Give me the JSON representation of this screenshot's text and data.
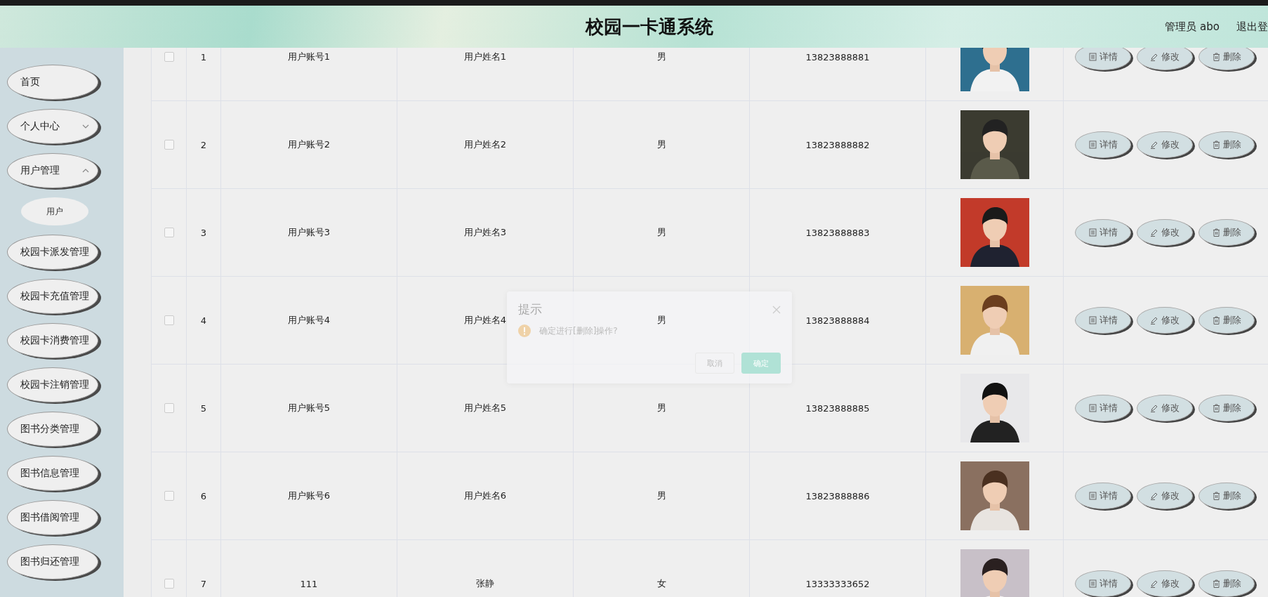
{
  "header": {
    "title": "校园一卡通系统",
    "user_label": "管理员 abo",
    "logout": "退出登"
  },
  "sidebar": {
    "items": [
      {
        "label": "首页",
        "kind": "link"
      },
      {
        "label": "个人中心",
        "kind": "submenu",
        "expanded": false
      },
      {
        "label": "用户管理",
        "kind": "submenu",
        "expanded": true,
        "children": [
          {
            "label": "用户"
          }
        ]
      },
      {
        "label": "校园卡派发管理",
        "kind": "link"
      },
      {
        "label": "校园卡充值管理",
        "kind": "link"
      },
      {
        "label": "校园卡消费管理",
        "kind": "link"
      },
      {
        "label": "校园卡注销管理",
        "kind": "link"
      },
      {
        "label": "图书分类管理",
        "kind": "link"
      },
      {
        "label": "图书信息管理",
        "kind": "link"
      },
      {
        "label": "图书借阅管理",
        "kind": "link"
      },
      {
        "label": "图书归还管理",
        "kind": "link"
      }
    ]
  },
  "table": {
    "rows": [
      {
        "checked": false,
        "index": "1",
        "account": "用户账号1",
        "name": "用户姓名1",
        "gender": "男",
        "phone": "13823888881",
        "actions": [
          {
            "label": "详情",
            "kind": "detail"
          },
          {
            "label": "修改",
            "kind": "edit"
          },
          {
            "label": "删除",
            "kind": "delete"
          }
        ]
      },
      {
        "checked": false,
        "index": "2",
        "account": "用户账号2",
        "name": "用户姓名2",
        "gender": "男",
        "phone": "13823888882",
        "actions": [
          {
            "label": "详情",
            "kind": "detail"
          },
          {
            "label": "修改",
            "kind": "edit"
          },
          {
            "label": "删除",
            "kind": "delete"
          }
        ]
      },
      {
        "checked": false,
        "index": "3",
        "account": "用户账号3",
        "name": "用户姓名3",
        "gender": "男",
        "phone": "13823888883",
        "actions": [
          {
            "label": "详情",
            "kind": "detail"
          },
          {
            "label": "修改",
            "kind": "edit"
          },
          {
            "label": "删除",
            "kind": "delete"
          }
        ]
      },
      {
        "checked": false,
        "index": "4",
        "account": "用户账号4",
        "name": "用户姓名4",
        "gender": "男",
        "phone": "13823888884",
        "actions": [
          {
            "label": "详情",
            "kind": "detail"
          },
          {
            "label": "修改",
            "kind": "edit"
          },
          {
            "label": "删除",
            "kind": "delete"
          }
        ]
      },
      {
        "checked": false,
        "index": "5",
        "account": "用户账号5",
        "name": "用户姓名5",
        "gender": "男",
        "phone": "13823888885",
        "actions": [
          {
            "label": "详情",
            "kind": "detail"
          },
          {
            "label": "修改",
            "kind": "edit"
          },
          {
            "label": "删除",
            "kind": "delete"
          }
        ]
      },
      {
        "checked": false,
        "index": "6",
        "account": "用户账号6",
        "name": "用户姓名6",
        "gender": "男",
        "phone": "13823888886",
        "actions": [
          {
            "label": "详情",
            "kind": "detail"
          },
          {
            "label": "修改",
            "kind": "edit"
          },
          {
            "label": "删除",
            "kind": "delete"
          }
        ]
      },
      {
        "checked": false,
        "index": "7",
        "account": "111",
        "name": "张静",
        "gender": "女",
        "phone": "13333333652",
        "actions": [
          {
            "label": "详情",
            "kind": "detail"
          },
          {
            "label": "修改",
            "kind": "edit"
          },
          {
            "label": "删除",
            "kind": "delete"
          }
        ]
      }
    ]
  },
  "dialog": {
    "title": "提示",
    "message": "确定进行[删除]操作?",
    "buttons": [
      {
        "label": "取消",
        "kind": "cancel"
      },
      {
        "label": "确定",
        "kind": "confirm"
      }
    ]
  }
}
